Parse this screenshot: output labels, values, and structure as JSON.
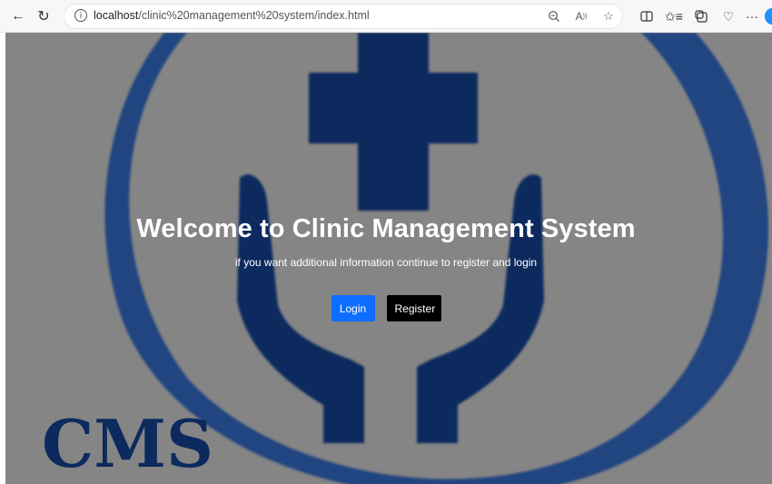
{
  "browser": {
    "url_host": "localhost",
    "url_path": "/clinic%20management%20system/index.html"
  },
  "logo": {
    "text": "CMS",
    "primary_color": "#0c2a5e",
    "secondary_color": "#14418a"
  },
  "hero": {
    "title": "Welcome to Clinic Management System",
    "subtitle": "if you want additional information continue to register and login"
  },
  "actions": {
    "login_label": "Login",
    "register_label": "Register"
  },
  "colors": {
    "login_bg": "#0d6efd",
    "register_bg": "#000000",
    "overlay": "#808080"
  },
  "icons": [
    "back-icon",
    "refresh-icon",
    "info-icon",
    "zoom-icon",
    "read-aloud-icon",
    "favorite-icon",
    "split-screen-icon",
    "favorites-list-icon",
    "collections-icon",
    "browser-essentials-icon",
    "more-icon",
    "copilot-icon"
  ]
}
